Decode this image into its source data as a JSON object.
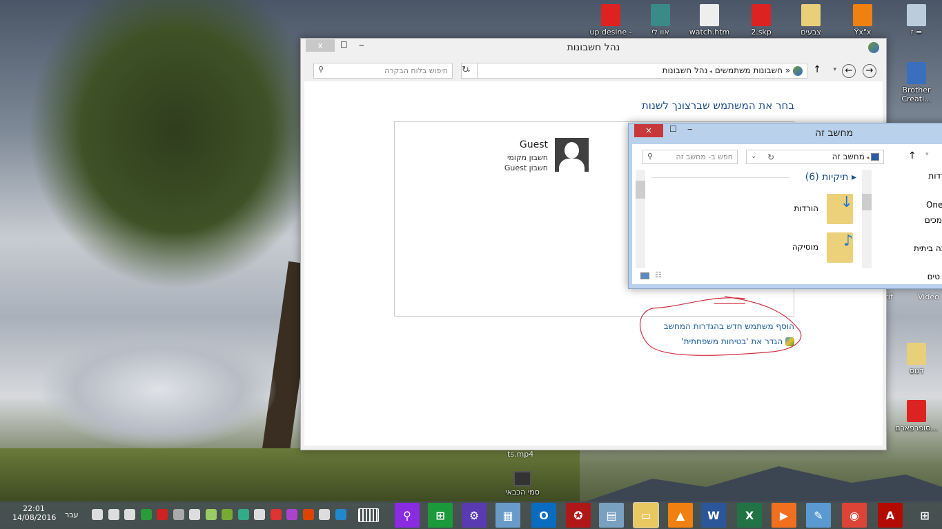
{
  "desktop": {
    "top_icons": [
      {
        "label": "up desine -",
        "color": "#d22"
      },
      {
        "label": "אוו לי",
        "color": "#3a8a8a"
      },
      {
        "label": "watch.htm",
        "color": "#eee"
      },
      {
        "label": "2.skp",
        "color": "#d22"
      },
      {
        "label": "צבעים",
        "color": "#e8cf7a"
      },
      {
        "label": "Ÿx\"x",
        "color": "#f08010"
      },
      {
        "label": "ז =",
        "color": "#bcd"
      }
    ],
    "right_icons": [
      {
        "label": "Brother Creati...",
        "color": "#3a6fc0"
      },
      {
        "label": "דנוס",
        "color": "#e8cf7a"
      },
      {
        "label": "סופרפארם...",
        "color": "#d22"
      }
    ],
    "partial_labels": {
      "df": "df",
      "video": "Video",
      "mp4": "ts.mp4"
    },
    "video_file": {
      "label": "סמי הכבאי"
    }
  },
  "accounts_window": {
    "title": "נהל חשבונות",
    "close": "x",
    "breadcrumb": [
      "חשבונות משתמשים",
      "נהל חשבונות"
    ],
    "breadcrumb_chevron": "«",
    "search_placeholder": "חיפוש בלוח הבקרה",
    "heading": "בחר את המשתמש שברצונך לשנות",
    "account": {
      "name": "Guest",
      "line1": "חשבון מקומי",
      "line2": "חשבון Guest"
    },
    "links": [
      "הוסף משתמש חדש בהגדרות המחשב",
      "הגדר את 'בטיחות משפחתית'"
    ]
  },
  "explorer_window": {
    "title": "מחשב זה",
    "close": "×",
    "address": "מחשב זה",
    "search_placeholder": "חפש ב- מחשב זה",
    "group_header": "תיקיות (6)",
    "folders": [
      {
        "label": "הורדות",
        "badge": "↓"
      },
      {
        "label": "מוסיקה",
        "badge": "♪"
      }
    ],
    "nav_items": [
      "הורדות",
      "OneDriv",
      "מסמכים",
      "בוצה ביתית",
      "טים"
    ]
  },
  "taskbar": {
    "time": "22:01",
    "date": "14/08/2016",
    "language": "עבר",
    "tray_colors": [
      "#ddd",
      "#ddd",
      "#ddd",
      "#2a9a3a",
      "#c22",
      "#aaa",
      "#ddd",
      "#9c6",
      "#7a3",
      "#3a8",
      "#ddd",
      "#d33",
      "#a4c",
      "#d40",
      "#ddd",
      "#28c"
    ],
    "apps": [
      {
        "name": "search",
        "glyph": "⚲",
        "color": "#8a2be2"
      },
      {
        "name": "store",
        "glyph": "⊞",
        "color": "#1a9a3a"
      },
      {
        "name": "settings",
        "glyph": "⚙",
        "color": "#5a3ab0"
      },
      {
        "name": "control-panel",
        "glyph": "▦",
        "color": "#6a9ac8"
      },
      {
        "name": "outlook",
        "glyph": "O",
        "color": "#0a6cc0"
      },
      {
        "name": "game-booster",
        "glyph": "✪",
        "color": "#b01818"
      },
      {
        "name": "calculator",
        "glyph": "▤",
        "color": "#7aa0c0"
      },
      {
        "name": "file-explorer",
        "glyph": "▭",
        "color": "#e8c860"
      },
      {
        "name": "vlc",
        "glyph": "▲",
        "color": "#f08010"
      },
      {
        "name": "word",
        "glyph": "W",
        "color": "#2b579a"
      },
      {
        "name": "excel",
        "glyph": "X",
        "color": "#217346"
      },
      {
        "name": "media-player",
        "glyph": "▶",
        "color": "#f07020"
      },
      {
        "name": "paint",
        "glyph": "✎",
        "color": "#5a9ad0"
      },
      {
        "name": "chrome",
        "glyph": "◉",
        "color": "#db4437"
      },
      {
        "name": "acrobat",
        "glyph": "A",
        "color": "#b30b00"
      },
      {
        "name": "start",
        "glyph": "⊞",
        "color": "transparent"
      }
    ]
  }
}
